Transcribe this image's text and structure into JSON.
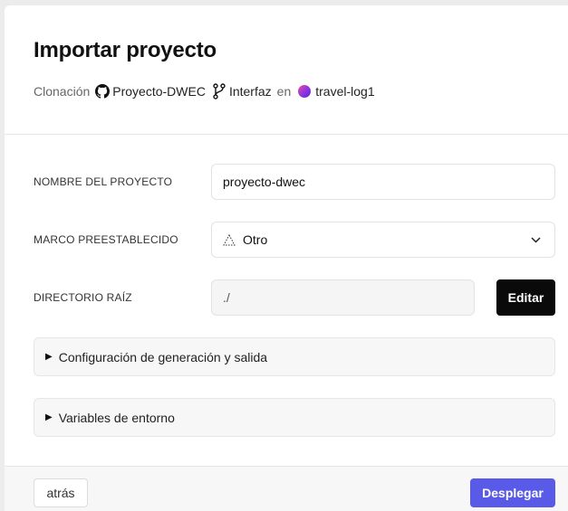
{
  "header": {
    "title": "Importar proyecto",
    "clone_label": "Clonación",
    "repo_name": "Proyecto-DWEC",
    "branch_name": "Interfaz",
    "in_label": "en",
    "team_name": "travel-log1"
  },
  "form": {
    "project_name": {
      "label": "NOMBRE DEL PROYECTO",
      "value": "proyecto-dwec"
    },
    "framework": {
      "label": "MARCO PREESTABLECIDO",
      "value": "Otro",
      "icon": "triangle-outline-icon"
    },
    "root_dir": {
      "label": "DIRECTORIO RAÍZ",
      "value": "./",
      "edit_label": "Editar"
    }
  },
  "sections": [
    {
      "label": "Configuración de generación y salida"
    },
    {
      "label": "Variables de entorno"
    }
  ],
  "footer": {
    "back_label": "atrás",
    "deploy_label": "Desplegar"
  },
  "colors": {
    "accent": "#5a5ae8",
    "edit_button": "#0a0a0a"
  }
}
